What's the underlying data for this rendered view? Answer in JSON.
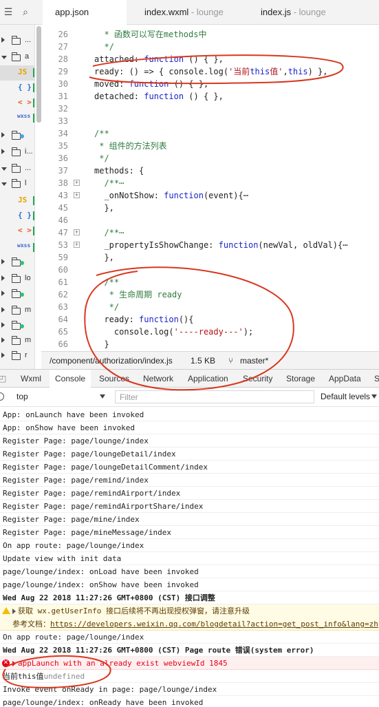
{
  "tabs": [
    {
      "name": "app.json",
      "sub": ""
    },
    {
      "name": "index.wxml",
      "sub": " - lounge"
    },
    {
      "name": "index.js",
      "sub": " - lounge"
    }
  ],
  "tree": {
    "rows": [
      {
        "kind": "folder",
        "label": "..."
      },
      {
        "kind": "folder",
        "label": "a"
      },
      {
        "kind": "file",
        "type": "JS",
        "color": "#e8a000"
      },
      {
        "kind": "file",
        "type": "{ }",
        "color": "#2a6fdb"
      },
      {
        "kind": "file",
        "type": "< >",
        "color": "#e05a1c"
      },
      {
        "kind": "file",
        "type": "wxss",
        "color": "#3166c9"
      },
      {
        "kind": "folder",
        "label": ""
      },
      {
        "kind": "folder",
        "label": "i..."
      },
      {
        "kind": "folder",
        "label": "..."
      },
      {
        "kind": "folder",
        "label": "l"
      },
      {
        "kind": "file",
        "type": "JS",
        "color": "#e8a000"
      },
      {
        "kind": "file",
        "type": "{ }",
        "color": "#2a6fdb"
      },
      {
        "kind": "file",
        "type": "< >",
        "color": "#e05a1c"
      },
      {
        "kind": "file",
        "type": "wxss",
        "color": "#3166c9"
      },
      {
        "kind": "folder",
        "label": ""
      },
      {
        "kind": "folder",
        "label": "lo"
      },
      {
        "kind": "folder",
        "label": ""
      },
      {
        "kind": "folder",
        "label": "m"
      },
      {
        "kind": "folder",
        "label": ""
      },
      {
        "kind": "folder",
        "label": "m"
      },
      {
        "kind": "folder",
        "label": "r"
      }
    ]
  },
  "editor": {
    "lines": [
      {
        "n": "26",
        "text": "  * 函数可以写在methods中"
      },
      {
        "n": "27",
        "text": "  */"
      },
      {
        "n": "28",
        "text": "attached: function () { },"
      },
      {
        "n": "29",
        "text": "ready: () => { console.log('当前this值',this) },"
      },
      {
        "n": "30",
        "text": "moved: function () { },"
      },
      {
        "n": "31",
        "text": "detached: function () { },"
      },
      {
        "n": "32",
        "text": ""
      },
      {
        "n": "33",
        "text": ""
      },
      {
        "n": "34",
        "text": "/**"
      },
      {
        "n": "35",
        "text": " * 组件的方法列表"
      },
      {
        "n": "36",
        "text": " */"
      },
      {
        "n": "37",
        "text": "methods: {"
      },
      {
        "n": "38",
        "text": "  /**⋯"
      },
      {
        "n": "43",
        "text": "  _onNotShow: function(event){⋯"
      },
      {
        "n": "45",
        "text": "  },"
      },
      {
        "n": "46",
        "text": ""
      },
      {
        "n": "47",
        "text": "  /**⋯"
      },
      {
        "n": "53",
        "text": "  _propertyIsShowChange: function(newVal, oldVal){⋯"
      },
      {
        "n": "59",
        "text": "  },"
      },
      {
        "n": "60",
        "text": ""
      },
      {
        "n": "61",
        "text": "  /**"
      },
      {
        "n": "62",
        "text": "   * 生命周期 ready"
      },
      {
        "n": "63",
        "text": "   */"
      },
      {
        "n": "64",
        "text": "  ready: function(){"
      },
      {
        "n": "65",
        "text": "    console.log('----ready---');"
      },
      {
        "n": "66",
        "text": "  }"
      }
    ]
  },
  "status": {
    "path": "/component/authorization/index.js",
    "size": "1.5 KB",
    "branch": "master*"
  },
  "devtools": {
    "tabs": [
      "Wxml",
      "Console",
      "Sources",
      "Network",
      "Application",
      "Security",
      "Storage",
      "AppData",
      "S"
    ],
    "active": "Console"
  },
  "console_toolbar": {
    "context": "top",
    "filter_placeholder": "Filter",
    "levels": "Default levels"
  },
  "console": [
    {
      "kind": "log",
      "text": "App: onLaunch have been invoked"
    },
    {
      "kind": "log",
      "text": "App: onShow have been invoked"
    },
    {
      "kind": "log",
      "text": "Register Page: page/lounge/index"
    },
    {
      "kind": "log",
      "text": "Register Page: page/loungeDetail/index"
    },
    {
      "kind": "log",
      "text": "Register Page: page/loungeDetailComment/index"
    },
    {
      "kind": "log",
      "text": "Register Page: page/remind/index"
    },
    {
      "kind": "log",
      "text": "Register Page: page/remindAirport/index"
    },
    {
      "kind": "log",
      "text": "Register Page: page/remindAirportShare/index"
    },
    {
      "kind": "log",
      "text": "Register Page: page/mine/index"
    },
    {
      "kind": "log",
      "text": "Register Page: page/mineMessage/index"
    },
    {
      "kind": "log",
      "text": "On app route: page/lounge/index"
    },
    {
      "kind": "log",
      "text": "Update view with init data"
    },
    {
      "kind": "log",
      "text": "page/lounge/index: onLoad have been invoked"
    },
    {
      "kind": "log",
      "text": "page/lounge/index: onShow have been invoked"
    },
    {
      "kind": "bold",
      "text": "Wed Aug 22 2018 11:27:26 GMT+0800 (CST) 接口调整"
    },
    {
      "kind": "warn",
      "text": "获取 wx.getUserInfo 接口后续将不再出现授权弹窗，请注意升级",
      "text2": "参考文档：",
      "link": "https://developers.weixin.qq.com/blogdetail?action=get_post_info&lang=zh"
    },
    {
      "kind": "log",
      "text": "On app route: page/lounge/index"
    },
    {
      "kind": "bold",
      "text": "Wed Aug 22 2018 11:27:26 GMT+0800 (CST) Page route 错误(system error)"
    },
    {
      "kind": "err",
      "text": "appLaunch with an already exist webviewId 1845"
    },
    {
      "kind": "val",
      "text": "当前this值",
      "value": "undefined"
    },
    {
      "kind": "log",
      "text": "Invoke event onReady in page: page/lounge/index"
    },
    {
      "kind": "log",
      "text": "page/lounge/index: onReady have been invoked"
    }
  ]
}
